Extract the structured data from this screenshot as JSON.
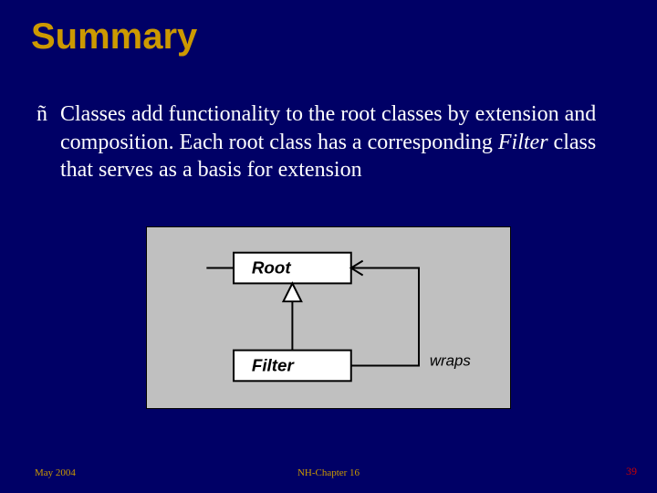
{
  "title": "Summary",
  "bullet": {
    "marker": "ñ",
    "pre": "Classes add functionality to the root classes by extension and composition. Each root class has a corresponding ",
    "em": "Filter",
    "post": " class that serves as a basis for extension"
  },
  "diagram": {
    "root_label": "Root",
    "filter_label": "Filter",
    "wraps_label": "wraps"
  },
  "footer": {
    "left": "May 2004",
    "center": "NH-Chapter 16",
    "page": "39"
  }
}
